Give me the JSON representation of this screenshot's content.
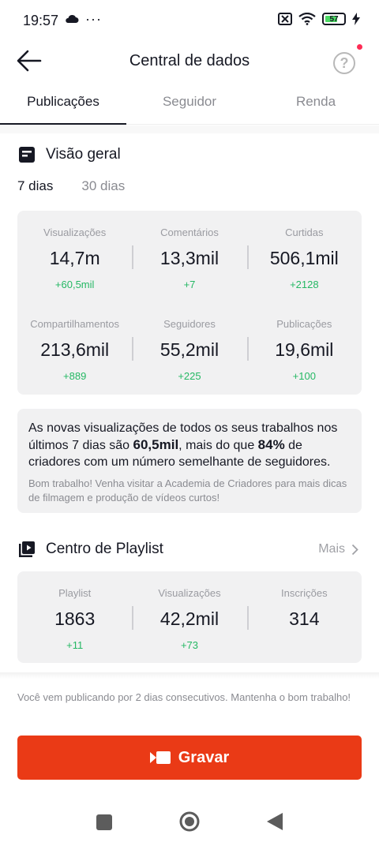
{
  "status_bar": {
    "time": "19:57",
    "dots": "···",
    "battery": "57",
    "icons": [
      "cloud-icon",
      "sim-icon",
      "wifi-icon",
      "battery-icon",
      "charging-icon"
    ]
  },
  "header": {
    "title": "Central de dados",
    "help_label": "?"
  },
  "tabs": [
    {
      "label": "Publicações",
      "active": true
    },
    {
      "label": "Seguidor",
      "active": false
    },
    {
      "label": "Renda",
      "active": false
    }
  ],
  "overview": {
    "title": "Visão geral",
    "periods": [
      {
        "label": "7 dias",
        "active": true
      },
      {
        "label": "30 dias",
        "active": false
      }
    ],
    "stats": [
      {
        "label": "Visualizações",
        "value": "14,7m",
        "delta": "+60,5mil"
      },
      {
        "label": "Comentários",
        "value": "13,3mil",
        "delta": "+7"
      },
      {
        "label": "Curtidas",
        "value": "506,1mil",
        "delta": "+2128"
      },
      {
        "label": "Compartilhamentos",
        "value": "213,6mil",
        "delta": "+889"
      },
      {
        "label": "Seguidores",
        "value": "55,2mil",
        "delta": "+225"
      },
      {
        "label": "Publicações",
        "value": "19,6mil",
        "delta": "+100"
      }
    ]
  },
  "insight": {
    "part1": "As novas visualizações de todos os seus trabalhos nos últimos 7 dias são ",
    "highlight1": "60,5mil",
    "part2": ", mais do que ",
    "highlight2": "84%",
    "part3": " de criadores com um número semelhante de seguidores.",
    "tip": "Bom trabalho! Venha visitar a Academia de Criadores para mais dicas de filmagem e produção de vídeos curtos!"
  },
  "playlist": {
    "title": "Centro de Playlist",
    "more_label": "Mais",
    "stats": [
      {
        "label": "Playlist",
        "value": "1863",
        "delta": "+11"
      },
      {
        "label": "Visualizações",
        "value": "42,2mil",
        "delta": "+73"
      },
      {
        "label": "Inscrições",
        "value": "314",
        "delta": ""
      }
    ]
  },
  "footer": {
    "note": "Você vem publicando por 2 dias consecutivos. Mantenha o bom trabalho!",
    "record_label": "Gravar"
  },
  "colors": {
    "accent": "#ea3a16",
    "positive": "#25b864",
    "card_bg": "#f1f1f2",
    "notification_dot": "#fe2c55"
  }
}
